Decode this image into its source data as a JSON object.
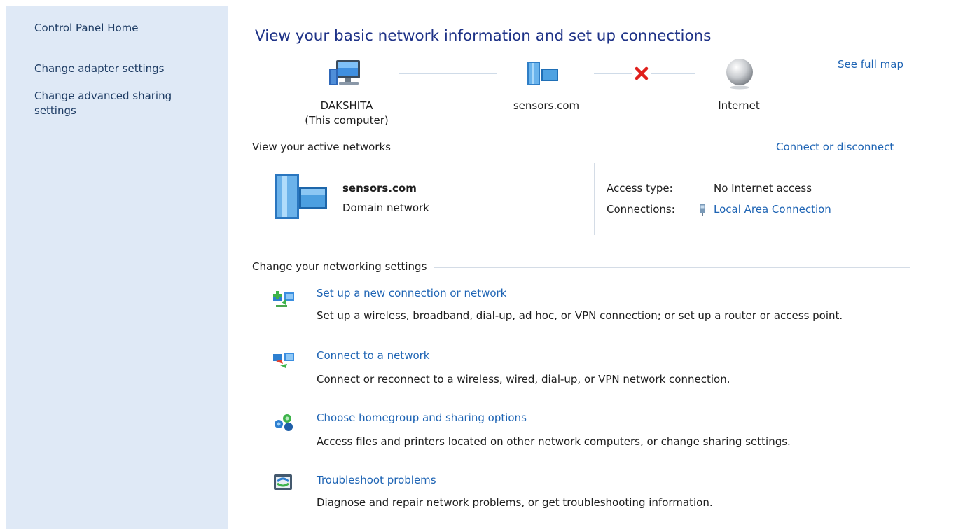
{
  "sidebar": {
    "home_label": "Control Panel Home",
    "items": [
      {
        "label": "Change adapter settings"
      },
      {
        "label": "Change advanced sharing"
      },
      {
        "label": "settings"
      }
    ]
  },
  "main": {
    "title": "View your basic network information and set up connections",
    "see_full_map": "See full map",
    "map": {
      "computer_name": "DAKSHITA",
      "computer_sub": "(This computer)",
      "network_name": "sensors.com",
      "internet_label": "Internet",
      "internet_status": "disconnected"
    },
    "active_networks": {
      "heading": "View your active networks",
      "connect_link": "Connect or disconnect",
      "network": {
        "name": "sensors.com",
        "type": "Domain network"
      },
      "access_type_label": "Access type:",
      "access_type_value": "No Internet access",
      "connections_label": "Connections:",
      "connections_value": "Local Area Connection"
    },
    "settings": {
      "heading": "Change your networking settings",
      "tasks": [
        {
          "icon": "new-connection-icon",
          "link": "Set up a new connection or network",
          "desc": "Set up a wireless, broadband, dial-up, ad hoc, or VPN connection; or set up a router or access point."
        },
        {
          "icon": "connect-network-icon",
          "link": "Connect to a network",
          "desc": "Connect or reconnect to a wireless, wired, dial-up, or VPN network connection."
        },
        {
          "icon": "homegroup-icon",
          "link": "Choose homegroup and sharing options",
          "desc": "Access files and printers located on other network computers, or change sharing settings."
        },
        {
          "icon": "troubleshoot-icon",
          "link": "Troubleshoot problems",
          "desc": "Diagnose and repair network problems, or get troubleshooting information."
        }
      ]
    }
  },
  "colors": {
    "sidebar_bg": "#dfe9f6",
    "title": "#1e3287",
    "link": "#1e64b4",
    "error_x": "#e0201c"
  }
}
